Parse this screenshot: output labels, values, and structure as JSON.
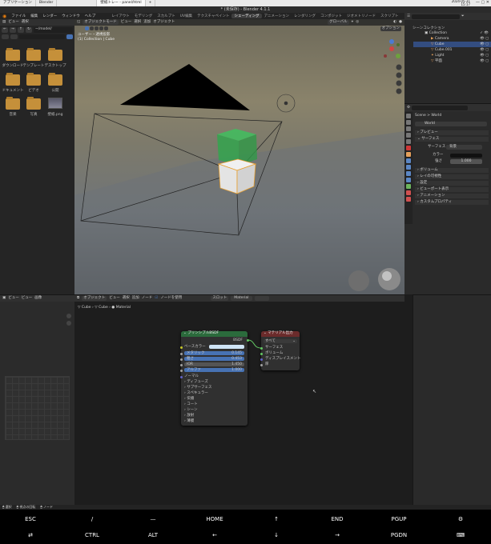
{
  "os": {
    "tabs": [
      "アプリケーション",
      "Blender",
      "",
      "壁紙トレー - panel/html",
      "+"
    ],
    "clock_time": "2024-05-31",
    "clock_time2": "15:17"
  },
  "window_title": "* (未保存) - Blender 4.1.1",
  "menus": [
    "ファイル",
    "編集",
    "レンダー",
    "ウィンドウ",
    "ヘルプ"
  ],
  "workspaces": [
    "レイアウト",
    "モデリング",
    "スカルプト",
    "UV編集",
    "テクスチャペイント",
    "シェーディング",
    "アニメーション",
    "レンダリング",
    "コンポジット",
    "ジオメトリノード",
    "スクリプト"
  ],
  "active_workspace": "シェーディング",
  "scene": {
    "label": "Scene",
    "view_layer": "ViewLayer"
  },
  "file_browser": {
    "header": [
      "ビュー",
      "選択"
    ],
    "path": "~/model/",
    "items": [
      "ダウンロード",
      "テンプレート",
      "デスクトップ",
      "ドキュメント",
      "ビデオ",
      "公開",
      "音楽",
      "写真",
      "壁紙.png"
    ]
  },
  "viewport": {
    "header": [
      "オブジェクトモード",
      "ビュー",
      "選択",
      "追加",
      "オブジェクト"
    ],
    "shading": "グローバル",
    "overlay_title": "ユーザー・透視投影",
    "overlay_sub": "(1) Collection | Cube",
    "options_label": "オプション"
  },
  "outliner": {
    "title": "シーンコレクション",
    "rows": [
      "Collection",
      "Camera",
      "Cube",
      "Cube.001",
      "Light",
      "平面"
    ]
  },
  "properties": {
    "search_placeholder": "",
    "breadcrumb": [
      "Scene",
      "World"
    ],
    "world_name": "World",
    "sections": [
      "プレビュー",
      "サーフェス"
    ],
    "surface_label": "サーフェス",
    "surface_value": "背景",
    "color_label": "カラー",
    "strength_label": "強さ",
    "strength_value": "1.000",
    "collapsed": [
      "ボリューム",
      "レイの可視性",
      "設定",
      "ビューポート表示",
      "アニメーション",
      "カスタムプロパティ"
    ]
  },
  "image_editor": {
    "header": [
      "ビュー",
      "ビュー",
      "画像"
    ]
  },
  "node_editor": {
    "header": [
      "オブジェクト",
      "ビュー",
      "選択",
      "追加",
      "ノード",
      "ノードを使用"
    ],
    "slot": "スロット",
    "material": "Material",
    "breadcrumb": [
      "Cube",
      "Cube",
      "Material"
    ],
    "principled": {
      "title": "プリンシプルBSDF",
      "output": "BSDF",
      "rows": [
        {
          "label": "ベースカラー",
          "value": ""
        },
        {
          "label": "メタリック",
          "value": "0.145"
        },
        {
          "label": "粗さ",
          "value": "0.453"
        },
        {
          "label": "IOR",
          "value": "1.450"
        },
        {
          "label": "アルファ",
          "value": "1.000"
        }
      ],
      "normal": "ノーマル",
      "panels": [
        "ディフューズ",
        "サブサーフェス",
        "スペキュラー",
        "伝播",
        "コート",
        "シーン",
        "放射",
        "薄膜"
      ]
    },
    "output": {
      "title": "マテリアル出力",
      "target": "すべて",
      "inputs": [
        "サーフェス",
        "ボリューム",
        "ディスプレイスメント",
        "厚"
      ]
    }
  },
  "status_bar": [
    "選択",
    "視点の回転",
    "ノード"
  ],
  "keyboard": {
    "row1": [
      "ESC",
      "/",
      "—",
      "HOME",
      "↑",
      "END",
      "PGUP",
      "⚙"
    ],
    "row2": [
      "⇄",
      "CTRL",
      "ALT",
      "←",
      "↓",
      "→",
      "PGDN",
      "⌨"
    ]
  },
  "colors": {
    "accent": "#4772b3",
    "node_green": "#2b6b3c",
    "node_red": "#6b2b2b",
    "folder": "#c5903a"
  }
}
